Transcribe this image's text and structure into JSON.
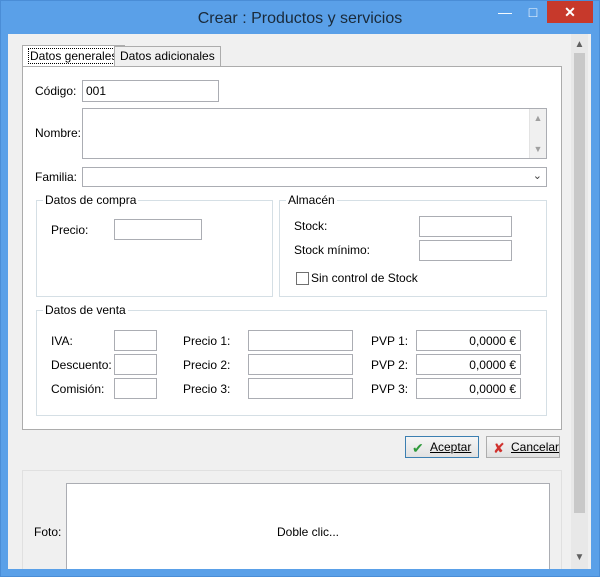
{
  "window": {
    "title": "Crear : Productos y servicios",
    "minimize_glyph": "—",
    "maximize_glyph": "□",
    "close_glyph": "✕"
  },
  "tabs": [
    {
      "label": "Datos generales",
      "active": true
    },
    {
      "label": "Datos adicionales",
      "active": false
    }
  ],
  "general": {
    "codigo_label": "Código:",
    "codigo_value": "001",
    "nombre_label": "Nombre:",
    "nombre_value": "",
    "familia_label": "Familia:",
    "familia_value": ""
  },
  "compra": {
    "title": "Datos de compra",
    "precio_label": "Precio:",
    "precio_value": ""
  },
  "almacen": {
    "title": "Almacén",
    "stock_label": "Stock:",
    "stock_value": "",
    "stock_minimo_label": "Stock mínimo:",
    "stock_minimo_value": "",
    "sin_control_label": "Sin control de Stock",
    "sin_control_checked": false
  },
  "venta": {
    "title": "Datos de venta",
    "iva_label": "IVA:",
    "descuento_label": "Descuento:",
    "comision_label": "Comisión:",
    "precio1_label": "Precio 1:",
    "precio2_label": "Precio 2:",
    "precio3_label": "Precio 3:",
    "pvp1_label": "PVP 1:",
    "pvp2_label": "PVP 2:",
    "pvp3_label": "PVP 3:",
    "pvp1_value": "0,0000 €",
    "pvp2_value": "0,0000 €",
    "pvp3_value": "0,0000 €"
  },
  "buttons": {
    "accept_label": "Aceptar",
    "cancel_label": "Cancelar"
  },
  "foto": {
    "label": "Foto:",
    "placeholder": "Doble clic..."
  },
  "icons": {
    "accept": "check-icon",
    "cancel": "x-icon",
    "dropdown": "chevron-down-icon",
    "scroll_up": "chevron-up-icon",
    "scroll_down": "chevron-down-icon"
  },
  "colors": {
    "titlebar": "#5aa0e8",
    "close_button": "#c7392b",
    "accept_icon": "#2e9a3a",
    "cancel_icon": "#d0312d"
  }
}
